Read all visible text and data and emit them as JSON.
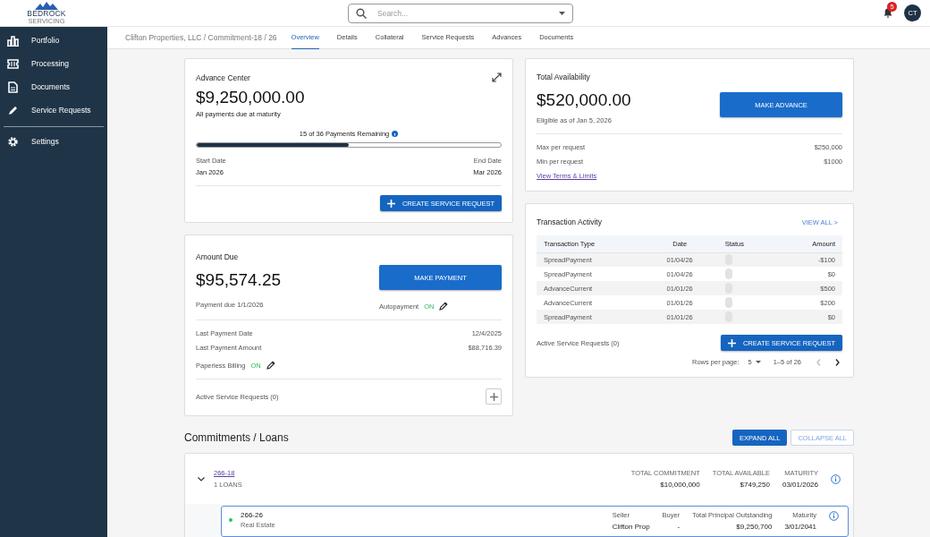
{
  "header": {
    "logo": {
      "name": "BEDROCK",
      "tagline": "SERVICING"
    },
    "search": {
      "placeholder": "Search..."
    },
    "notifications": {
      "count": "5"
    },
    "avatar": {
      "initials": "CT"
    }
  },
  "sidebar": {
    "items": [
      {
        "label": "Portfolio"
      },
      {
        "label": "Processing"
      },
      {
        "label": "Documents"
      },
      {
        "label": "Service Requests"
      }
    ],
    "footer_items": [
      {
        "label": "Settings"
      }
    ]
  },
  "breadcrumb": "Clifton Properties, LLC / Commitment-18 / 26",
  "tabs": [
    {
      "label": "Overview",
      "selected": true
    },
    {
      "label": "Details",
      "selected": false
    },
    {
      "label": "Collateral",
      "selected": false
    },
    {
      "label": "Service Requests",
      "selected": false
    },
    {
      "label": "Advances",
      "selected": false
    },
    {
      "label": "Documents",
      "selected": false
    }
  ],
  "advance_center": {
    "title": "Advance Center",
    "amount": "$9,250,000.00",
    "subtitle": "All payments due at maturity",
    "progress": {
      "label": "15 of 36 Payments Remaining",
      "level": 0.5
    },
    "start": {
      "label": "Start Date",
      "value": "Jan 2026"
    },
    "end": {
      "label": "End Date",
      "value": "Mar 2026"
    },
    "button": "CREATE SERVICE REQUEST"
  },
  "amount_due": {
    "title": "Amount Due",
    "amount": "$95,574.25",
    "button": "MAKE PAYMENT",
    "due": "Payment due 1/1/2026",
    "autopay": {
      "label": "Autopayment",
      "value": "ON",
      "on": true
    },
    "rows": [
      {
        "label": "Last Payment Date",
        "value": "12/4/2025"
      },
      {
        "label": "Last Payment Amount",
        "value": "$88,716.39"
      }
    ],
    "paperless": {
      "label": "Paperless Billing",
      "value": "ON",
      "on": true
    },
    "active_requests": "Active Service Requests (0)"
  },
  "availability": {
    "title": "Total Availability",
    "amount": "$520,000.00",
    "button": "MAKE ADVANCE",
    "eligible": "Eligible as of Jan 5, 2026",
    "rows": [
      {
        "label": "Max per request",
        "value": "$250,000"
      },
      {
        "label": "Min per request",
        "value": "$1000"
      }
    ],
    "link": "View Terms & Limits"
  },
  "transactions": {
    "title": "Transaction Activity",
    "view_all": "VIEW ALL >",
    "columns": [
      "Transaction Type",
      "Date",
      "Status",
      "Amount"
    ],
    "rows": [
      {
        "type": "SpreadPayment",
        "date": "01/04/26",
        "amount": "-$100"
      },
      {
        "type": "SpreadPayment",
        "date": "01/04/26",
        "amount": "$0"
      },
      {
        "type": "AdvanceCurrent",
        "date": "01/01/26",
        "amount": "$500"
      },
      {
        "type": "AdvanceCurrent",
        "date": "01/01/26",
        "amount": "$200"
      },
      {
        "type": "SpreadPayment",
        "date": "01/01/26",
        "amount": "$0"
      }
    ],
    "active_requests": "Active Service Requests (0)",
    "button": "CREATE SERVICE REQUEST",
    "pagination": {
      "label": "Rows per page:",
      "rows_value": "5",
      "range": "1–5 of 26",
      "prev_disabled": true,
      "next_disabled": false
    }
  },
  "commitments": {
    "title": "Commitments / Loans",
    "expand": "EXPAND ALL",
    "collapse": "COLLAPSE ALL",
    "groups": [
      {
        "id": "266-18",
        "count": "1 LOANS",
        "expanded": true,
        "stats": [
          {
            "label": "TOTAL COMMITMENT",
            "value": "$10,000,000"
          },
          {
            "label": "TOTAL AVAILABLE",
            "value": "$749,250"
          },
          {
            "label": "MATURITY",
            "value": "03/01/2026"
          }
        ],
        "loans": [
          {
            "id": "266-26",
            "type": "Real Estate",
            "active": true,
            "fields": [
              {
                "label": "Seller",
                "value": "Clifton Prop"
              },
              {
                "label": "Buyer",
                "value": "-"
              },
              {
                "label": "Total Principal Outstanding",
                "value": "$9,250,700"
              },
              {
                "label": "Maturity",
                "value": "3/01/2041"
              }
            ]
          }
        ]
      }
    ]
  }
}
